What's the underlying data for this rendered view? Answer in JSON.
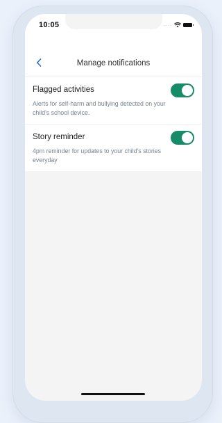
{
  "status": {
    "time": "10:05",
    "signal_dots": "....",
    "icons": [
      "wifi-icon",
      "battery-icon"
    ]
  },
  "header": {
    "title": "Manage notifications",
    "back_icon": "chevron-left-icon"
  },
  "settings": [
    {
      "title": "Flagged activities",
      "description": "Alerts for self-harm and bullying detected on your child's school device.",
      "enabled": true
    },
    {
      "title": "Story reminder",
      "description": "4pm reminder for updates to your child's stories everyday",
      "enabled": true
    }
  ],
  "colors": {
    "accent": "#168b68",
    "link": "#1f6fd6",
    "background": "#eaf1fb"
  }
}
